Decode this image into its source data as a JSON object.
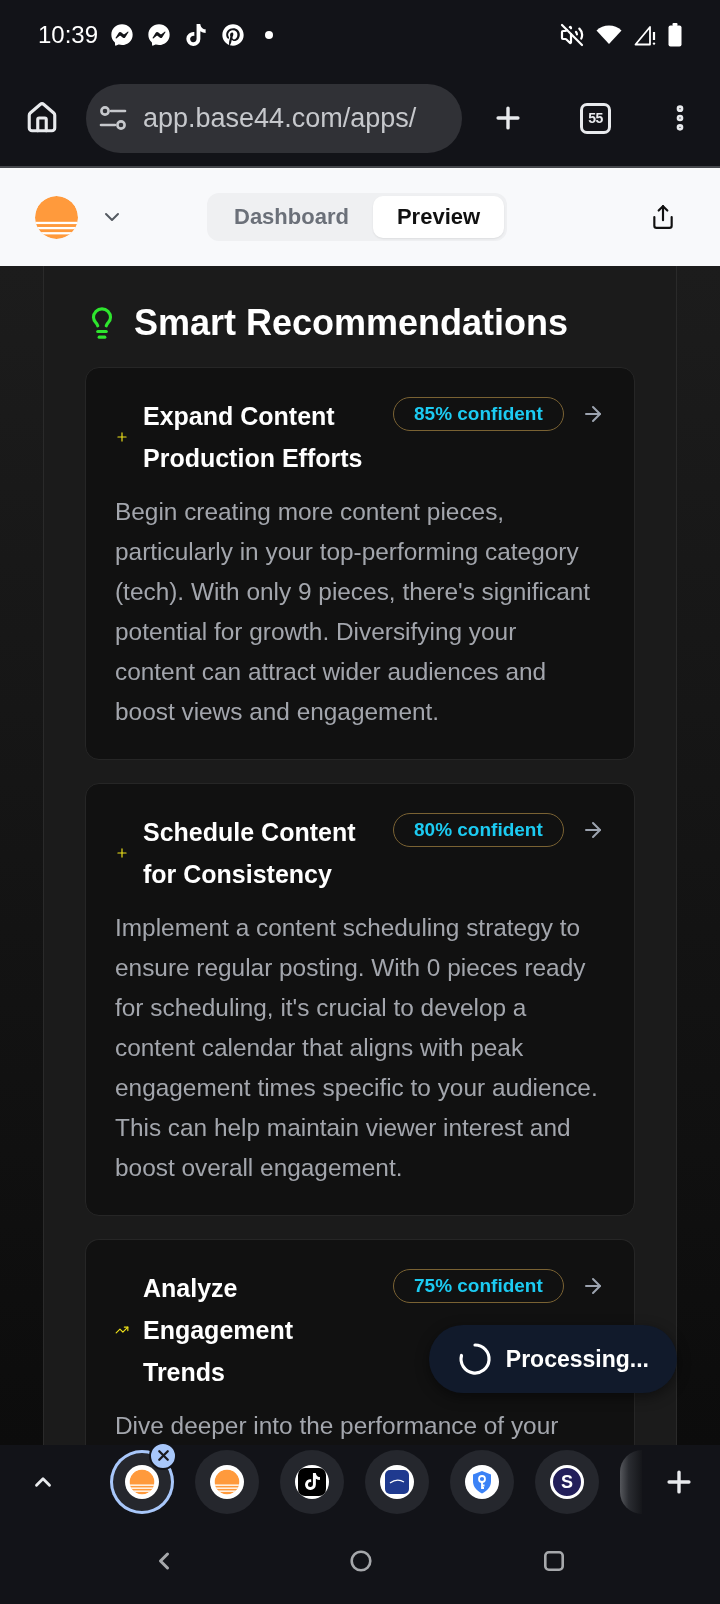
{
  "status_bar": {
    "time": "10:39"
  },
  "browser": {
    "url": "app.base44.com/apps/",
    "tab_count": "55"
  },
  "app_header": {
    "tabs": [
      {
        "label": "Dashboard",
        "selected": false
      },
      {
        "label": "Preview",
        "selected": true
      }
    ]
  },
  "recommendations": {
    "title": "Smart Recommendations",
    "items": [
      {
        "kind": "plus",
        "title": "Expand Content Production Efforts",
        "confidence": "85% confident",
        "description": "Begin creating more content pieces, particularly in your top-performing category (tech). With only 9 pieces, there's significant potential for growth. Diversifying your content can attract wider audiences and boost views and engagement."
      },
      {
        "kind": "plus",
        "title": "Schedule Content for Consistency",
        "confidence": "80% confident",
        "description": "Implement a content scheduling strategy to ensure regular posting. With 0 pieces ready for scheduling, it's crucial to develop a content calendar that aligns with peak engagement times specific to your audience. This can help maintain viewer interest and boost overall engagement."
      },
      {
        "kind": "trend",
        "title": "Analyze Engagement Trends",
        "confidence": "75% confident",
        "description": "Dive deeper into the performance of your"
      }
    ]
  },
  "toast": {
    "text": "Processing..."
  },
  "tab_strip": {
    "tabs": [
      {
        "kind": "sunset",
        "selected": true
      },
      {
        "kind": "sunset",
        "selected": false
      },
      {
        "kind": "note",
        "selected": false
      },
      {
        "kind": "flow",
        "selected": false
      },
      {
        "kind": "shield",
        "selected": false
      },
      {
        "kind": "letter",
        "label": "S",
        "selected": false
      },
      {
        "kind": "faded",
        "selected": false
      }
    ]
  }
}
